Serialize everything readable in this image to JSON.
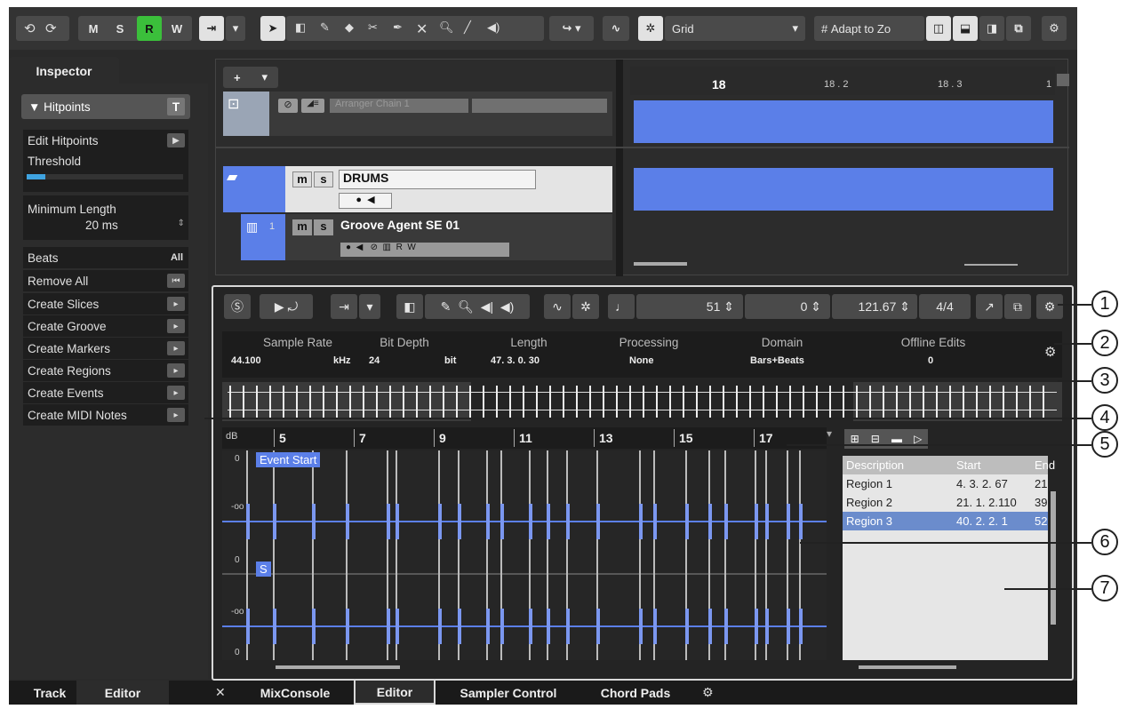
{
  "toolbar": {
    "undo_icon": "undo-icon",
    "redo_icon": "redo-icon",
    "m": "M",
    "s": "S",
    "r": "R",
    "w": "W",
    "snap_label": "Grid",
    "zoom_label": "Adapt to Zo"
  },
  "inspector": {
    "tab": "Inspector",
    "section": "Hitpoints",
    "edit_hitpoints": "Edit Hitpoints",
    "threshold": "Threshold",
    "threshold_value": 0.12,
    "min_length": "Minimum Length",
    "min_length_value": "20 ms",
    "beats": "Beats",
    "beats_value": "All",
    "remove_all": "Remove All",
    "actions": [
      "Create Slices",
      "Create Groove",
      "Create Markers",
      "Create Regions",
      "Create Events",
      "Create MIDI Notes"
    ]
  },
  "project": {
    "ruler": [
      "18",
      "18 . 2",
      "18 . 3",
      "1"
    ],
    "arranger_chain": "Arranger Chain 1",
    "track1": "DRUMS",
    "track2": "Groove Agent SE 01",
    "track2_num": "1",
    "m": "m",
    "s": "s"
  },
  "editor": {
    "tempo": "51",
    "offset": "0",
    "bpm": "121.67",
    "sig": "4/4",
    "info_headers": [
      "Sample Rate",
      "Bit Depth",
      "Length",
      "Processing",
      "Domain",
      "Offline Edits"
    ],
    "info_values": [
      "44.100",
      "kHz",
      "24",
      "bit",
      "47. 3. 0. 30",
      "None",
      "Bars+Beats",
      "0"
    ],
    "db_label": "dB",
    "bars": [
      "5",
      "7",
      "9",
      "11",
      "13",
      "15",
      "17"
    ],
    "event_start": "Event Start",
    "s_marker": "S",
    "scale": [
      "0",
      "-oo",
      "0",
      "-oo",
      "0"
    ],
    "regions_header": [
      "Description",
      "Start",
      "End"
    ],
    "regions": [
      {
        "name": "Region 1",
        "start": "4. 3. 2. 67",
        "end": "21"
      },
      {
        "name": "Region 2",
        "start": "21. 1. 2.110",
        "end": "39"
      },
      {
        "name": "Region 3",
        "start": "40. 2. 2. 1",
        "end": "52"
      }
    ]
  },
  "tabs": {
    "left": [
      "Track",
      "Editor"
    ],
    "bottom": [
      "MixConsole",
      "Editor",
      "Sampler Control",
      "Chord Pads"
    ]
  },
  "callouts": [
    "1",
    "2",
    "3",
    "4",
    "5",
    "6",
    "7"
  ],
  "colors": {
    "accent": "#5b7fe8",
    "active_green": "#3bbf3b",
    "selected_row": "#6b8ccc"
  }
}
